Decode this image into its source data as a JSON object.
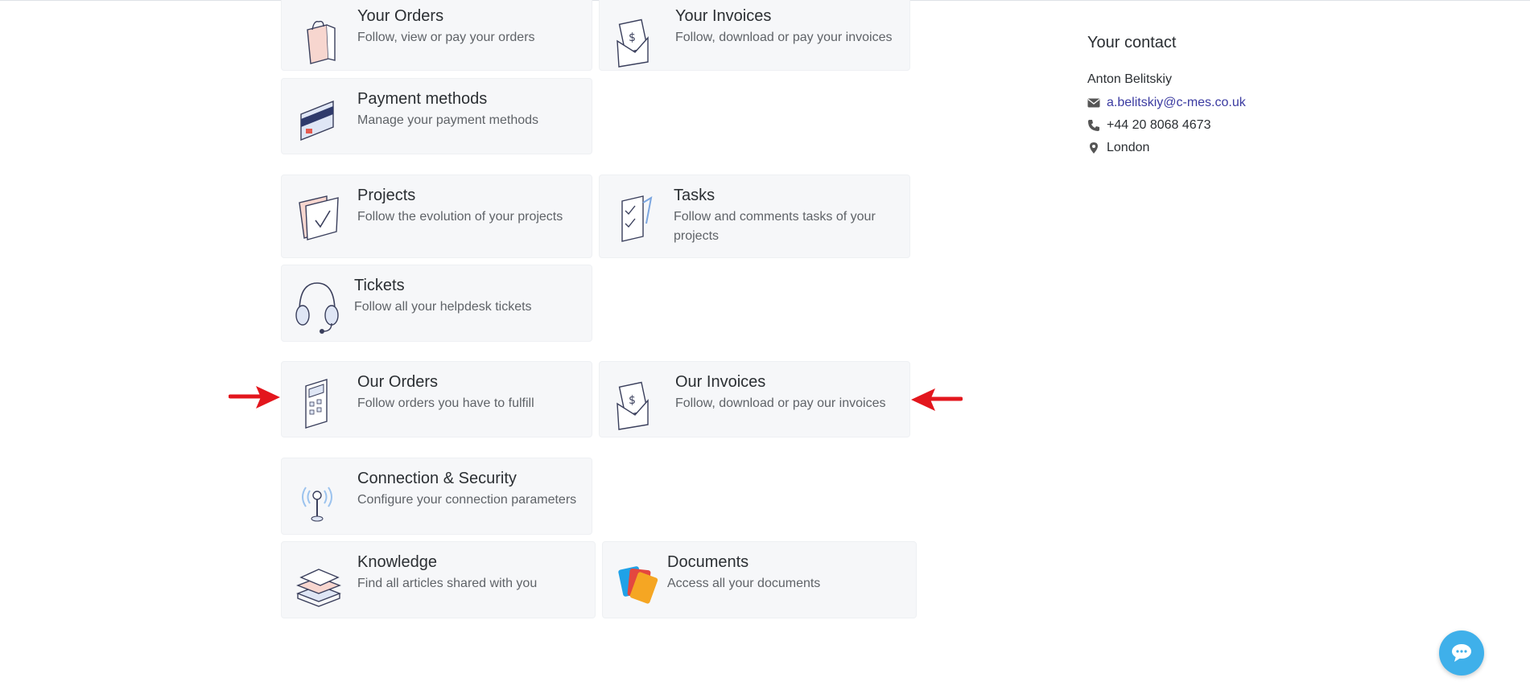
{
  "cards": {
    "your_orders": {
      "title": "Your Orders",
      "desc": "Follow, view or pay your orders"
    },
    "your_invoices": {
      "title": "Your Invoices",
      "desc": "Follow, download or pay your invoices"
    },
    "payment_methods": {
      "title": "Payment methods",
      "desc": "Manage your payment methods"
    },
    "projects": {
      "title": "Projects",
      "desc": "Follow the evolution of your projects"
    },
    "tasks": {
      "title": "Tasks",
      "desc": "Follow and comments tasks of your projects"
    },
    "tickets": {
      "title": "Tickets",
      "desc": "Follow all your helpdesk tickets"
    },
    "our_orders": {
      "title": "Our Orders",
      "desc": "Follow orders you have to fulfill"
    },
    "our_invoices": {
      "title": "Our Invoices",
      "desc": "Follow, download or pay our invoices"
    },
    "connection_security": {
      "title": "Connection & Security",
      "desc": "Configure your connection parameters"
    },
    "knowledge": {
      "title": "Knowledge",
      "desc": "Find all articles shared with you"
    },
    "documents": {
      "title": "Documents",
      "desc": "Access all your documents"
    }
  },
  "contact": {
    "title": "Your contact",
    "name": "Anton Belitskiy",
    "email": "a.belitskiy@c-mes.co.uk",
    "phone": "+44 20 8068 4673",
    "city": "London"
  },
  "icons": {
    "email": "envelope-icon",
    "phone": "phone-icon",
    "location": "map-marker-icon",
    "chat": "chat-bubble-icon"
  },
  "colors": {
    "card_bg": "#f6f7f9",
    "link": "#3b3ba1",
    "annotation_arrow": "#e3161d",
    "chat_button": "#3fb0ea"
  }
}
